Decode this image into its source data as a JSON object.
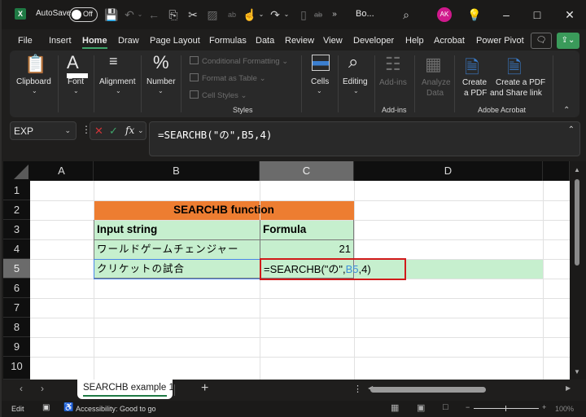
{
  "titlebar": {
    "app_logo": "X",
    "autosave_label": "AutoSave",
    "autosave_state": "Off",
    "doc_title": "Bo...",
    "user_initials": "AK",
    "avatar_color": "#d0198c",
    "icons": [
      "save-icon",
      "undo-icon",
      "back-icon",
      "copy-icon",
      "cut-icon",
      "image-icon",
      "spelling-icon",
      "touch-mode-icon",
      "redo-icon",
      "new-file-icon",
      "strikethrough-icon",
      "more-icon"
    ]
  },
  "menu": {
    "tabs": [
      {
        "label": "File"
      },
      {
        "label": "Insert"
      },
      {
        "label": "Home",
        "active": true
      },
      {
        "label": "Draw"
      },
      {
        "label": "Page Layout"
      },
      {
        "label": "Formulas"
      },
      {
        "label": "Data"
      },
      {
        "label": "Review"
      },
      {
        "label": "View"
      },
      {
        "label": "Developer"
      },
      {
        "label": "Help"
      },
      {
        "label": "Acrobat"
      },
      {
        "label": "Power Pivot"
      }
    ]
  },
  "ribbon": {
    "clipboard": "Clipboard",
    "font": "Font",
    "alignment": "Alignment",
    "number": "Number",
    "conditional_formatting": "Conditional Formatting",
    "format_as_table": "Format as Table",
    "cell_styles": "Cell Styles",
    "styles_group": "Styles",
    "cells": "Cells",
    "editing": "Editing",
    "add_ins": "Add-ins",
    "add_ins_group": "Add-ins",
    "analyze_data_1": "Analyze",
    "analyze_data_2": "Data",
    "create_pdf_1": "Create",
    "create_pdf_2": "a PDF",
    "create_share_1": "Create a PDF",
    "create_share_2": "and Share link",
    "acrobat_group": "Adobe Acrobat"
  },
  "formula_bar": {
    "name_box": "EXP",
    "formula": "=SEARCHB(\"の\",B5,4)"
  },
  "grid": {
    "columns": [
      "A",
      "B",
      "C",
      "D"
    ],
    "selected_column": "C",
    "rows": [
      "1",
      "2",
      "3",
      "4",
      "5",
      "6",
      "7",
      "8",
      "9",
      "10"
    ],
    "selected_row": "5",
    "cells": {
      "B2": "SEARCHB function",
      "B3": "Input string",
      "C3": "Formula",
      "B4": "ワールドゲームチェンジャー",
      "C4": "21",
      "B5": "クリケットの試合",
      "C5_prefix": "=SEARCHB(\"の\",",
      "C5_ref": "B5",
      "C5_suffix": ",4)"
    },
    "colors": {
      "header_fill": "#ed7d31",
      "table_fill": "#c6efce",
      "edit_border": "#d11a1a",
      "ref_color": "#3d8fd8"
    }
  },
  "sheets": {
    "tabs": [
      "SEARCHB example 1"
    ],
    "add_label": "+"
  },
  "statusbar": {
    "mode": "Edit",
    "accessibility": "Accessibility: Good to go",
    "zoom": "100%"
  }
}
